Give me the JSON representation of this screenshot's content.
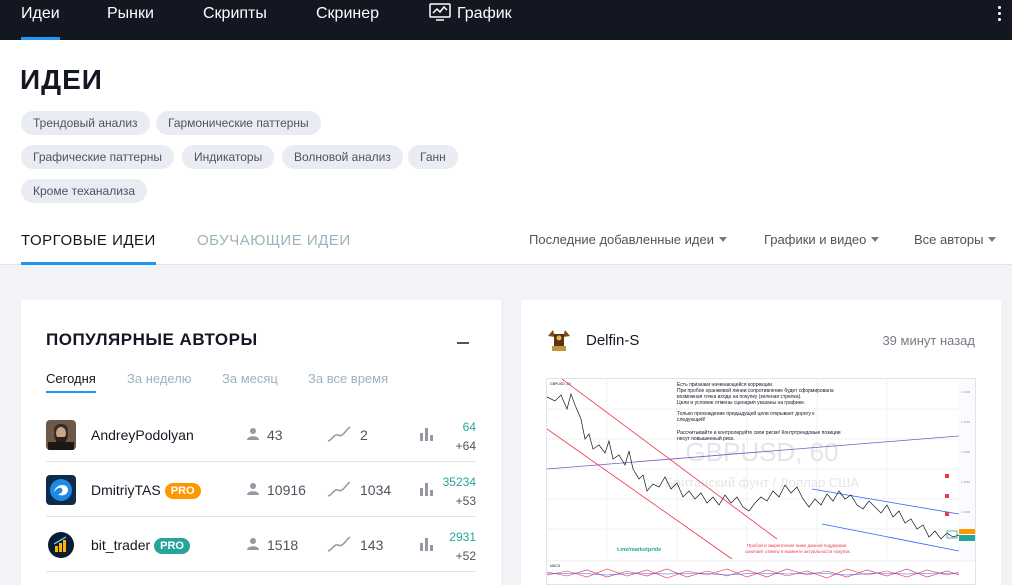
{
  "nav": {
    "items": [
      {
        "label": "Идеи"
      },
      {
        "label": "Рынки"
      },
      {
        "label": "Скрипты"
      },
      {
        "label": "Скринер"
      },
      {
        "label": "График"
      }
    ]
  },
  "header": {
    "title": "ИДЕИ",
    "tags": [
      "Трендовый анализ",
      "Гармонические паттерны",
      "Графические паттерны",
      "Индикаторы",
      "Волновой анализ",
      "Ганн",
      "Кроме теханализа"
    ],
    "tabs": [
      "ТОРГОВЫЕ ИДЕИ",
      "ОБУЧАЮЩИЕ ИДЕИ"
    ],
    "filters": [
      "Последние добавленные идеи",
      "Графики и видео",
      "Все авторы"
    ]
  },
  "authors": {
    "title": "ПОПУЛЯРНЫЕ АВТОРЫ",
    "periods": [
      "Сегодня",
      "За неделю",
      "За месяц",
      "За все время"
    ],
    "rows": [
      {
        "name": "AndreyPodolyan",
        "badge": "",
        "followers": "43",
        "ideas": "2",
        "reputation": "64",
        "delta": "+64"
      },
      {
        "name": "DmitriyTAS",
        "badge": "PRO",
        "followers": "10916",
        "ideas": "1034",
        "reputation": "35234",
        "delta": "+53"
      },
      {
        "name": "bit_trader",
        "badge": "PRO",
        "followers": "1518",
        "ideas": "143",
        "reputation": "2931",
        "delta": "+52"
      }
    ]
  },
  "idea": {
    "author": "Delfin-S",
    "time": "39 минут назад",
    "chart_symbol": "GBPUSD, 60",
    "chart_subtitle": "Британский фунт / Доллар США",
    "chart_watermark": "t.me/marketpride",
    "chart_header": "GBPUSD, 60",
    "chart_note_lines": [
      "Есть признаки начинающейся коррекции.",
      "При пробое оранжевой линии сопротивление будет сформирована",
      "возможная точка входа на покупку (зеленая стрелка).",
      "Цели и условие отмены сценария указаны на графике.",
      "Только прохождение предыдущей цели открывает дорогу к",
      "следующей!",
      "Рассчитывайте и контролируйте свои риски! Контртрендовые позиции",
      "несут повышенный риск."
    ],
    "chart_note2_lines": [
      "Пробой и закрепление ниже данной поддержки",
      "означает отмену в моменте актуальности покупок."
    ],
    "indicator_label": "MACD"
  },
  "colors": {
    "accent": "#2196f3",
    "nav_bg": "#131722",
    "positive": "#26a69a",
    "pro_orange": "#ff9800",
    "pro_green": "#26a69a"
  }
}
